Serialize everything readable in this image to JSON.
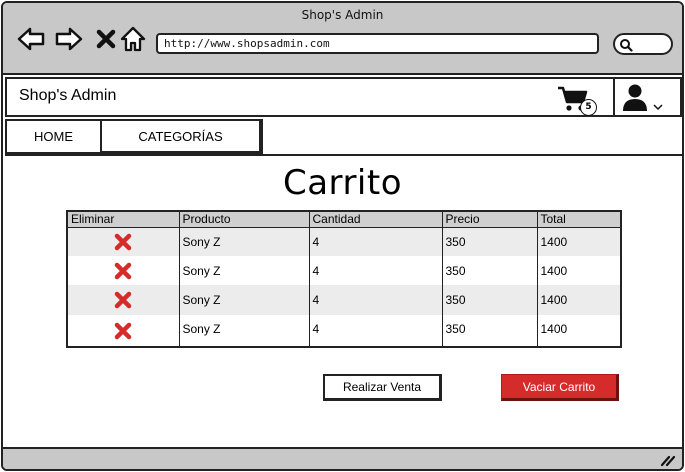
{
  "window": {
    "title": "Shop's Admin"
  },
  "browser": {
    "url": "http://www.shopsadmin.com"
  },
  "header": {
    "app_title": "Shop's Admin",
    "cart_count": "5"
  },
  "nav": {
    "tabs": [
      {
        "label": "HOME"
      },
      {
        "label": "CATEGORÍAS"
      }
    ]
  },
  "page": {
    "title": "Carrito"
  },
  "table": {
    "columns": [
      "Eliminar",
      "Producto",
      "Cantidad",
      "Precio",
      "Total"
    ],
    "rows": [
      {
        "producto": "Sony Z",
        "cantidad": "4",
        "precio": "350",
        "total": "1400"
      },
      {
        "producto": "Sony Z",
        "cantidad": "4",
        "precio": "350",
        "total": "1400"
      },
      {
        "producto": "Sony Z",
        "cantidad": "4",
        "precio": "350",
        "total": "1400"
      },
      {
        "producto": "Sony Z",
        "cantidad": "4",
        "precio": "350",
        "total": "1400"
      }
    ]
  },
  "actions": {
    "sale_label": "Realizar Venta",
    "empty_label": "Vaciar Carrito"
  },
  "colors": {
    "chrome": "#c8c8c8",
    "danger": "#d62b2b",
    "row_alt": "#ececec",
    "header_row": "#cfcfcf"
  },
  "icons": [
    "back-arrow-icon",
    "forward-arrow-icon",
    "close-icon",
    "home-icon",
    "search-icon",
    "cart-icon",
    "user-icon",
    "chevron-down-icon",
    "delete-x-icon",
    "resize-grip-icon"
  ]
}
